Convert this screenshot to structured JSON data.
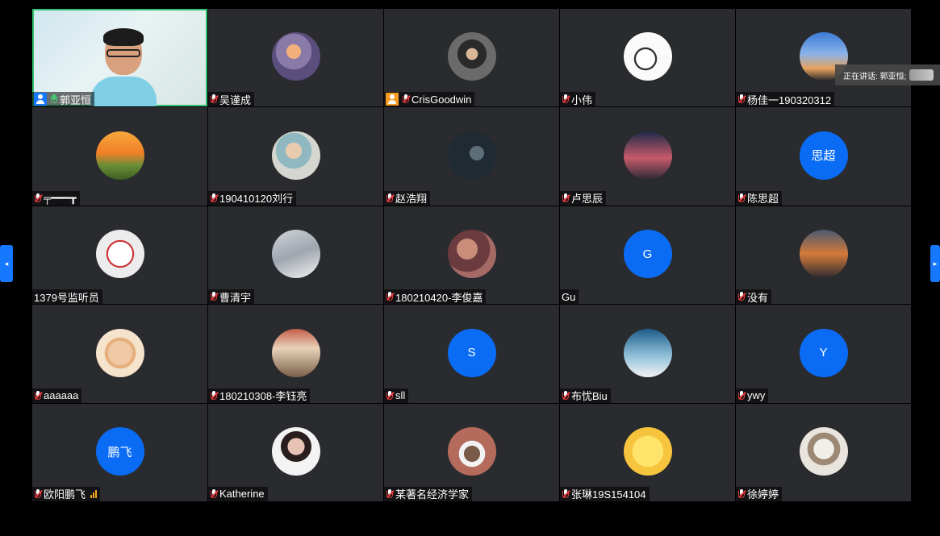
{
  "speaking_banner": {
    "text": "正在讲话: 郭亚恒;"
  },
  "paging": {
    "prev_icon": "◂",
    "next_icon": "▸"
  },
  "participants": [
    {
      "name": "郭亚恒",
      "type": "video",
      "mic": "on",
      "host": "blue"
    },
    {
      "name": "吴谨成",
      "type": "avatar",
      "img": "img1",
      "mic": "muted"
    },
    {
      "name": "CrisGoodwin",
      "type": "avatar",
      "img": "img2",
      "mic": "muted",
      "host": "orange"
    },
    {
      "name": "小伟",
      "type": "avatar",
      "img": "img3",
      "mic": "muted"
    },
    {
      "name": "杨佳一190320312",
      "type": "avatar",
      "img": "img4",
      "mic": "muted"
    },
    {
      "name": "╤━━━┳",
      "type": "avatar",
      "img": "img5",
      "mic": "muted"
    },
    {
      "name": "190410120刘行",
      "type": "avatar",
      "img": "img6",
      "mic": "muted"
    },
    {
      "name": "赵浩翔",
      "type": "avatar",
      "img": "img7",
      "mic": "muted"
    },
    {
      "name": "卢思辰",
      "type": "avatar",
      "img": "img8",
      "mic": "muted"
    },
    {
      "name": "陈思超",
      "type": "text",
      "avatar_text": "思超",
      "mic": "muted"
    },
    {
      "name": "1379号监听员",
      "type": "avatar",
      "img": "img9",
      "mic": "none"
    },
    {
      "name": "曹清宇",
      "type": "avatar",
      "img": "img10",
      "mic": "muted"
    },
    {
      "name": "180210420-李俊嘉",
      "type": "avatar",
      "img": "img11",
      "mic": "muted"
    },
    {
      "name": "Gu",
      "type": "text",
      "avatar_text": "G",
      "mic": "none"
    },
    {
      "name": "没有",
      "type": "avatar",
      "img": "img12",
      "mic": "muted"
    },
    {
      "name": "aaaaaa",
      "type": "avatar",
      "img": "img13",
      "mic": "muted"
    },
    {
      "name": "180210308-李钰亮",
      "type": "avatar",
      "img": "img14",
      "mic": "muted"
    },
    {
      "name": "sll",
      "type": "text",
      "avatar_text": "S",
      "mic": "muted"
    },
    {
      "name": "布忧Biu",
      "type": "avatar",
      "img": "img15",
      "mic": "muted"
    },
    {
      "name": "ywy",
      "type": "text",
      "avatar_text": "Y",
      "mic": "muted"
    },
    {
      "name": "欧阳鹏飞",
      "type": "text",
      "avatar_text": "鹏飞",
      "mic": "muted",
      "signal": true
    },
    {
      "name": "Katherine",
      "type": "avatar",
      "img": "img16",
      "mic": "muted"
    },
    {
      "name": "某著名经济学家",
      "type": "avatar",
      "img": "img17",
      "mic": "muted"
    },
    {
      "name": "张琳19S154104",
      "type": "avatar",
      "img": "img18",
      "mic": "muted"
    },
    {
      "name": "徐婷婷",
      "type": "avatar",
      "img": "img19",
      "mic": "muted"
    }
  ]
}
